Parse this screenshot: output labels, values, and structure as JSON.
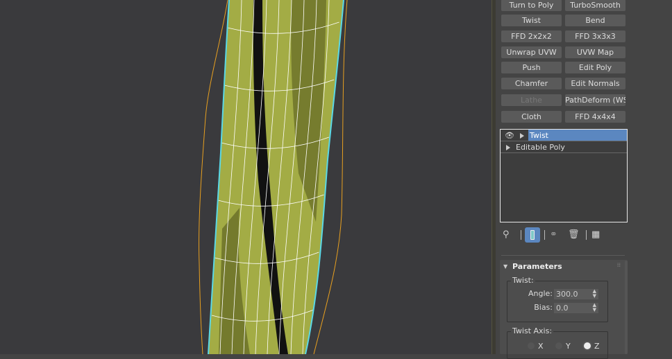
{
  "modifier_buttons": [
    {
      "label": "Turn to Poly",
      "enabled": true
    },
    {
      "label": "TurboSmooth",
      "enabled": true
    },
    {
      "label": "Twist",
      "enabled": true
    },
    {
      "label": "Bend",
      "enabled": true
    },
    {
      "label": "FFD 2x2x2",
      "enabled": true
    },
    {
      "label": "FFD 3x3x3",
      "enabled": true
    },
    {
      "label": "Unwrap UVW",
      "enabled": true
    },
    {
      "label": "UVW Map",
      "enabled": true
    },
    {
      "label": "Push",
      "enabled": true
    },
    {
      "label": "Edit Poly",
      "enabled": true
    },
    {
      "label": "Chamfer",
      "enabled": true
    },
    {
      "label": "Edit Normals",
      "enabled": true
    },
    {
      "label": "Lathe",
      "enabled": false
    },
    {
      "label": "PathDeform (WSM)",
      "enabled": true
    },
    {
      "label": "Cloth",
      "enabled": true
    },
    {
      "label": "FFD 4x4x4",
      "enabled": true
    }
  ],
  "stack": {
    "items": [
      {
        "label": "Twist",
        "selected": true,
        "icons": [
          "eye-icon",
          "expand-arrow-icon"
        ]
      },
      {
        "label": "Editable Poly",
        "selected": false,
        "icons": [
          "expand-arrow-icon"
        ]
      }
    ]
  },
  "stack_toolbar": [
    "pin-stack-icon",
    "show-end-result-icon",
    "make-unique-icon",
    "remove-modifier-icon",
    "configure-modifier-sets-icon"
  ],
  "parameters": {
    "title": "Parameters",
    "twist_group": "Twist:",
    "angle_label": "Angle:",
    "angle_value": "300.0",
    "bias_label": "Bias:",
    "bias_value": "0.0",
    "axis_group": "Twist Axis:",
    "axis_options": [
      "X",
      "Y",
      "Z"
    ],
    "axis_selected": "Z"
  },
  "colors": {
    "selection": "#5b87c0",
    "mesh": "#a9b24a",
    "wire": "#ffffff",
    "selection_outline": "#5ad8e6",
    "gizmo": "#e8a020"
  }
}
